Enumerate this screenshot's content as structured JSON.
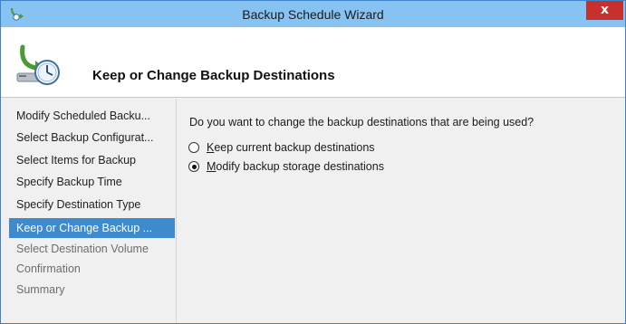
{
  "window": {
    "title": "Backup Schedule Wizard",
    "close_glyph": "x"
  },
  "header": {
    "title": "Keep or Change Backup Destinations",
    "icon": "backup-schedule-icon"
  },
  "steps": [
    {
      "label": "Modify Scheduled Backu...",
      "state": "done"
    },
    {
      "label": "Select Backup Configurat...",
      "state": "done"
    },
    {
      "label": "Select Items for Backup",
      "state": "done"
    },
    {
      "label": "Specify Backup Time",
      "state": "done"
    },
    {
      "label": "Specify Destination Type",
      "state": "done"
    },
    {
      "label": "Keep or Change Backup ...",
      "state": "current"
    },
    {
      "label": "Select Destination Volume",
      "state": "future"
    },
    {
      "label": "Confirmation",
      "state": "future"
    },
    {
      "label": "Summary",
      "state": "future"
    }
  ],
  "content": {
    "question": "Do you want to change the backup destinations that are being used?",
    "options": [
      {
        "access_key": "K",
        "rest": "eep current backup destinations",
        "selected": false
      },
      {
        "access_key": "M",
        "rest": "odify backup storage destinations",
        "selected": true
      }
    ]
  },
  "colors": {
    "titlebar": "#86c3f2",
    "close": "#c7302c",
    "current_step": "#3d8bcc"
  }
}
